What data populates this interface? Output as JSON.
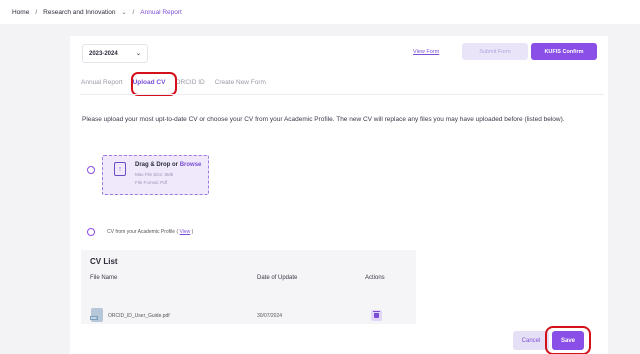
{
  "breadcrumb": {
    "home": "Home",
    "section": "Research and Innovation",
    "current": "Annual Report"
  },
  "year_select": {
    "value": "2023-2024"
  },
  "header_actions": {
    "view_form": "View Form",
    "submit_form": "Submit Form",
    "kufis_confirm": "KUFIS Confirm"
  },
  "tabs": [
    {
      "label": "Annual Report",
      "active": false
    },
    {
      "label": "Upload CV",
      "active": true
    },
    {
      "label": "ORCID ID",
      "active": false
    },
    {
      "label": "Create New Form",
      "active": false
    }
  ],
  "instruction": "Please upload your most upt-to-date CV or choose your CV from your Academic Profile. The new CV will replace any files you may have uploaded before (listed below).",
  "dropzone": {
    "title": "Drag & Drop or",
    "browse": "Browse",
    "max_size": "Max File Size: 5Mb",
    "format": "File Format: Pdf"
  },
  "profile_option": {
    "label": "CV from your Academic Profile",
    "view": "View"
  },
  "cv_list": {
    "title": "CV List",
    "columns": [
      "File Name",
      "Date of Update",
      "Actions"
    ],
    "rows": [
      {
        "file_name": "ORCID_ID_User_Guide.pdf",
        "date": "30/07/2024",
        "file_badge": "PDF"
      }
    ]
  },
  "footer": {
    "cancel": "Cancel",
    "save": "Save"
  },
  "colors": {
    "accent": "#8a4fe6",
    "highlight": "#d4111b"
  }
}
